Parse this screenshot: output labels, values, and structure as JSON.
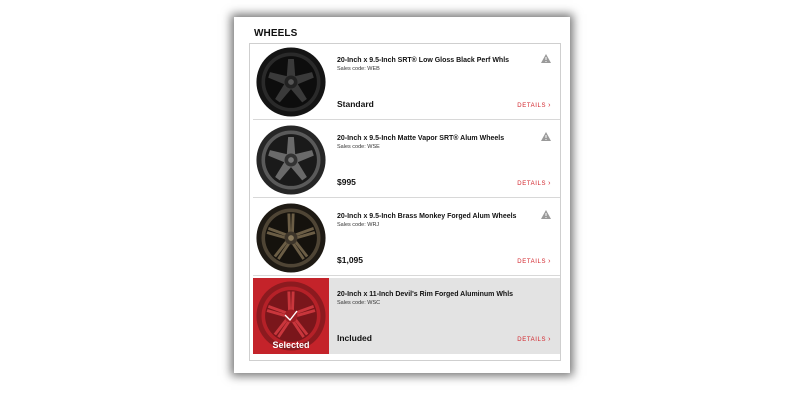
{
  "section": {
    "title": "WHEELS"
  },
  "wheels": [
    {
      "name": "20-Inch x 9.5-Inch SRT® Low Gloss Black Perf Whls",
      "sales_code": "Sales code: WEB",
      "price": "Standard",
      "details": "DETAILS",
      "color": "#1a1a1a",
      "selected": false,
      "warning": true
    },
    {
      "name": "20-Inch x 9.5-Inch Matte Vapor SRT® Alum Wheels",
      "sales_code": "Sales code: WSE",
      "price": "$995",
      "details": "DETAILS",
      "color": "#4a4a4a",
      "selected": false,
      "warning": true
    },
    {
      "name": "20-Inch x 9.5-Inch Brass Monkey Forged Alum Wheels",
      "sales_code": "Sales code: WRJ",
      "price": "$1,095",
      "details": "DETAILS",
      "color": "#4a3f30",
      "selected": false,
      "warning": true
    },
    {
      "name": "20-Inch x 11-Inch Devil's Rim Forged Aluminum Whls",
      "sales_code": "Sales code: WSC",
      "price": "Included",
      "details": "DETAILS",
      "color": "#a81c22",
      "selected": true,
      "selected_label": "Selected",
      "warning": false
    }
  ],
  "colors": {
    "accent": "#d2232a",
    "selected_bg": "#e3e3e3",
    "warning_icon": "#9a9a9a"
  },
  "icons": {
    "warning": "warning-triangle-icon",
    "details": "chevron-right-icon",
    "selected": "checkmark-icon"
  }
}
